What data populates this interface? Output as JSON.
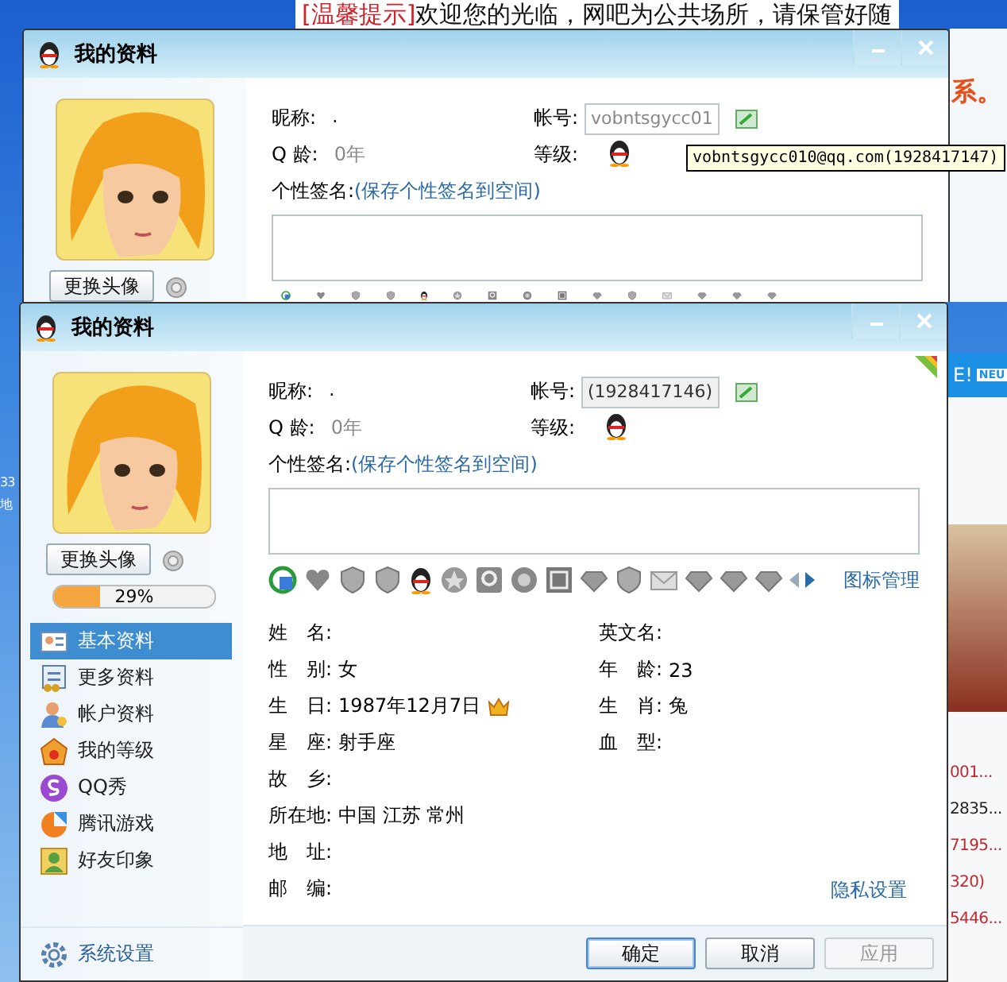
{
  "desktop": {
    "banner_tag": "[温馨提示]",
    "banner_text": "欢迎您的光临，网吧为公共场所，请保管好随",
    "banner_tail": "系。",
    "left_fragments": [
      "33",
      "地"
    ],
    "right_badge_text": "E!",
    "right_badge_label": "NEU",
    "right_list": [
      {
        "text": "001...",
        "color": "#c0282d"
      },
      {
        "text": "2835...",
        "color": "#222222"
      },
      {
        "text": "7195...",
        "color": "#c0282d"
      },
      {
        "text": "320)",
        "color": "#c0282d"
      },
      {
        "text": "5446...",
        "color": "#c0282d"
      }
    ]
  },
  "back_window": {
    "title": "我的资料",
    "change_avatar": "更换头像",
    "nickname_label": "昵称:",
    "nickname": ".",
    "account_label": "帐号:",
    "account": "vobntsgycc01",
    "qage_label": "Q 龄:",
    "qage": "0年",
    "level_label": "等级:",
    "signature_label": "个性签名:",
    "signature_link": "(保存个性签名到空间)"
  },
  "tooltip": "vobntsgycc010@qq.com(1928417147)",
  "front_window": {
    "title": "我的资料",
    "change_avatar": "更换头像",
    "progress": {
      "level": 0.29,
      "text": "29%"
    },
    "nav": [
      {
        "label": "基本资料",
        "selected": true
      },
      {
        "label": "更多资料",
        "selected": false
      },
      {
        "label": "帐户资料",
        "selected": false
      },
      {
        "label": "我的等级",
        "selected": false
      },
      {
        "label": "QQ秀",
        "selected": false
      },
      {
        "label": "腾讯游戏",
        "selected": false
      },
      {
        "label": "好友印象",
        "selected": false
      }
    ],
    "settings": "系统设置",
    "nickname_label": "昵称:",
    "nickname": ".",
    "account_label": "帐号:",
    "account": "(1928417146)",
    "qage_label": "Q 龄:",
    "qage": "0年",
    "level_label": "等级:",
    "signature_label": "个性签名:",
    "signature_link": "(保存个性签名到空间)",
    "icon_manage": "图标管理",
    "fields_left": [
      {
        "label": "姓　名:",
        "crown": false
      },
      {
        "label": "性　别:",
        "value": "女",
        "crown": false
      },
      {
        "label": "生　日:",
        "value": "1987年12月7日",
        "crown": true
      },
      {
        "label": "星　座:",
        "value": "射手座",
        "crown": false
      },
      {
        "label": "故　乡:",
        "crown": false
      },
      {
        "label": "所在地:",
        "value": "中国 江苏 常州",
        "crown": false
      },
      {
        "label": "地　址:",
        "crown": false
      },
      {
        "label": "邮　编:",
        "crown": false
      }
    ],
    "fields_right": [
      {
        "label": "英文名:"
      },
      {
        "label": "年　龄:",
        "value": "23"
      },
      {
        "label": "生　肖:",
        "value": "兔"
      },
      {
        "label": "血　型:"
      }
    ],
    "privacy": "隐私设置",
    "buttons": [
      {
        "label": "确定",
        "focused": true,
        "disabled": false
      },
      {
        "label": "取消",
        "focused": false,
        "disabled": false
      },
      {
        "label": "应用",
        "focused": false,
        "disabled": true
      }
    ]
  }
}
